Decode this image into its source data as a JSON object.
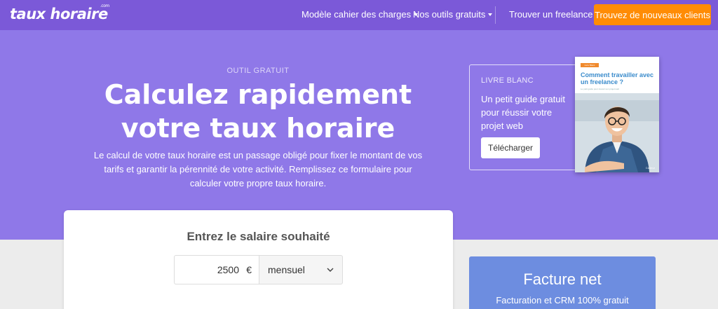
{
  "brand": {
    "name_part1": "taux ",
    "name_part2": "horaire",
    "tld": ".com"
  },
  "nav": {
    "items": [
      {
        "label": "Modèle cahier des charges",
        "dropdown": true
      },
      {
        "label": "Nos outils gratuits",
        "dropdown": true
      },
      {
        "label": "Trouver un freelance",
        "dropdown": false
      }
    ],
    "cta_label": "Trouvez de nouveaux clients"
  },
  "hero": {
    "kicker": "OUTIL GRATUIT",
    "title_line1": "Calculez rapidement",
    "title_line2": "votre taux horaire",
    "subtext": "Le calcul de votre taux horaire est un passage obligé pour fixer le montant de vos tarifs et garantir la pérennité de votre activité. Remplissez ce formulaire pour calculer votre propre taux horaire."
  },
  "white_paper": {
    "kicker": "LIVRE BLANC",
    "text": "Un petit guide gratuit pour réussir votre projet web",
    "button_label": "Télécharger",
    "book": {
      "tag": "Livre Blanc",
      "title": "Comment travailler avec un freelance ?",
      "subtitle": "Le petit guide pour réussir son projet web",
      "publisher": "Codeur"
    }
  },
  "calculator": {
    "title": "Entrez le salaire souhaité",
    "amount_value": "2500",
    "currency_symbol": "€",
    "period_selected": "mensuel"
  },
  "promo": {
    "title": "Facture net",
    "subtitle": "Facturation et CRM 100% gratuit"
  },
  "colors": {
    "navbar": "#7b59d8",
    "hero": "#8f78e8",
    "cta": "#ff8c05",
    "promo": "#6d8de0"
  }
}
